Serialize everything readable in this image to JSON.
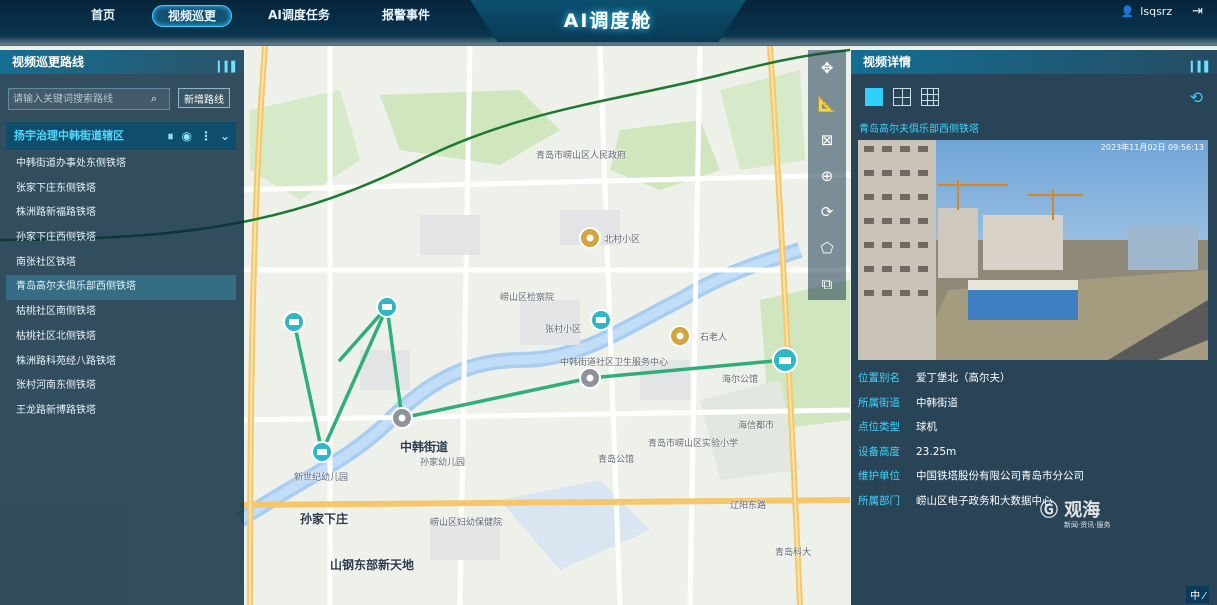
{
  "app": {
    "title": "AI调度舱"
  },
  "nav": [
    {
      "label": "首页",
      "active": false
    },
    {
      "label": "视频巡更",
      "active": true
    },
    {
      "label": "AI调度任务",
      "active": false
    },
    {
      "label": "报警事件",
      "active": false
    }
  ],
  "user": {
    "name": "lsqsrz"
  },
  "left_panel": {
    "title": "视频巡更路线",
    "search": {
      "placeholder": "请输入关键词搜索路线",
      "value": ""
    },
    "add_button": "新增路线",
    "route": {
      "name": "扬宇治理中韩街道辖区"
    },
    "towers": [
      "中韩街道办事处东侧铁塔",
      "张家下庄东侧铁塔",
      "株洲路新福路铁塔",
      "孙家下庄西侧铁塔",
      "南张社区铁塔",
      "青岛高尔夫俱乐部西侧铁塔",
      "枯桃社区南侧铁塔",
      "枯桃社区北侧铁塔",
      "株洲路科苑经八路铁塔",
      "张村河南东侧铁塔",
      "王龙路新博路铁塔"
    ],
    "selected_index": 5
  },
  "right_panel": {
    "title": "视频详情",
    "view_modes": [
      "1x1",
      "2x2",
      "3x3"
    ],
    "active_view_mode": 0,
    "camera_title": "青岛高尔夫俱乐部西侧铁塔",
    "video_timestamp": "2023年11月02日 09:56:13",
    "details": [
      {
        "key": "位置别名",
        "value": "爱丁堡北（高尔夫）"
      },
      {
        "key": "所属街道",
        "value": "中韩街道"
      },
      {
        "key": "点位类型",
        "value": "球机"
      },
      {
        "key": "设备高度",
        "value": "23.25m"
      },
      {
        "key": "维护单位",
        "value": "中国铁塔股份有限公司青岛市分公司"
      },
      {
        "key": "所属部门",
        "value": "崂山区电子政务和大数据中心"
      }
    ]
  },
  "map": {
    "labels": [
      "青岛市崂山区人民政府",
      "中韩街道",
      "孙家下庄",
      "张村小区",
      "石老人",
      "海信都市",
      "崂山区检察院",
      "辽阳东路",
      "青岛市崂山区实验小学",
      "海尔公馆",
      "新世纪幼儿园",
      "山钢东部新天地",
      "崂山区妇幼保健院",
      "青岛科大",
      "孙家幼儿园",
      "青岛公馆",
      "中韩街道社区卫生服务中心",
      "北村小区"
    ]
  },
  "watermark": {
    "brand": "观海",
    "sub": "新闻·资讯·服务"
  },
  "ime": "中 ⁄"
}
